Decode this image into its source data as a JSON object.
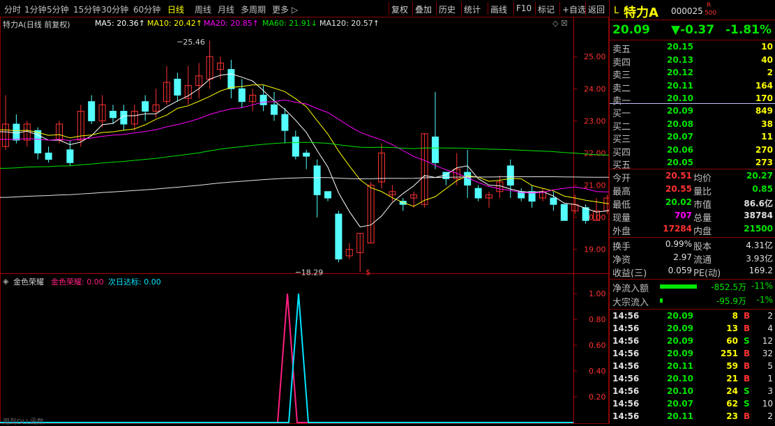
{
  "toolbar": {
    "left_items": [
      "分时",
      "1分钟",
      "5分钟",
      "15分钟",
      "30分钟",
      "60分钟",
      "日线",
      "周线",
      "月线",
      "多周期",
      "更多 ▷"
    ],
    "active_index": 6,
    "right_items": [
      "复权",
      "叠加",
      "历史",
      "统计",
      "画线",
      "F10",
      "标记",
      "+自选",
      "返回"
    ]
  },
  "chart_header": {
    "title": "特力A(日线 前复权)",
    "ma5": "MA5: 20.36↑",
    "ma10": "MA10: 20.42↑",
    "ma20": "MA20: 20.85↑",
    "ma60": "MA60: 21.91↓",
    "ma120": "MA120: 20.57↑",
    "icons": "◇ ☒"
  },
  "chart_data": [
    {
      "type": "candlestick",
      "ylim": [
        18.5,
        25.3
      ],
      "y_ticks": [
        "25.00",
        "24.00",
        "23.00",
        "22.00",
        "21.00",
        "20.00",
        "19.00"
      ],
      "annotations": [
        {
          "text": "25.46",
          "x": 16,
          "y": 25.46
        },
        {
          "text": "18.29",
          "x": 27,
          "y": 18.29
        },
        {
          "text": "$",
          "x": 33,
          "y": 18.3
        }
      ],
      "candles": [
        [
          22.2,
          22.9,
          22.1,
          23.8
        ],
        [
          22.9,
          22.4,
          22.3,
          23.2
        ],
        [
          22.4,
          22.9,
          22.2,
          23.0
        ],
        [
          22.7,
          22.0,
          21.8,
          22.8
        ],
        [
          22.0,
          21.8,
          21.7,
          22.2
        ],
        [
          22.4,
          22.9,
          22.3,
          23.0
        ],
        [
          22.1,
          21.7,
          21.6,
          22.4
        ],
        [
          22.4,
          23.3,
          22.2,
          23.5
        ],
        [
          23.6,
          23.0,
          22.9,
          23.8
        ],
        [
          23.0,
          23.5,
          22.8,
          23.8
        ],
        [
          23.3,
          23.1,
          22.9,
          23.5
        ],
        [
          23.3,
          22.9,
          22.7,
          23.5
        ],
        [
          22.9,
          23.3,
          22.7,
          23.5
        ],
        [
          23.6,
          23.3,
          23.0,
          23.8
        ],
        [
          23.3,
          23.5,
          23.1,
          24.0
        ],
        [
          23.6,
          24.2,
          23.5,
          24.7
        ],
        [
          24.3,
          23.8,
          23.6,
          24.5
        ],
        [
          23.7,
          24.1,
          23.5,
          24.7
        ],
        [
          24.1,
          24.4,
          23.7,
          24.8
        ],
        [
          24.3,
          25.0,
          24.0,
          25.5
        ],
        [
          24.6,
          24.8,
          24.3,
          25.0
        ],
        [
          24.6,
          24.0,
          23.7,
          24.9
        ],
        [
          24.0,
          23.6,
          23.4,
          24.3
        ],
        [
          23.6,
          23.8,
          23.3,
          24.0
        ],
        [
          23.8,
          23.5,
          23.3,
          24.1
        ],
        [
          23.5,
          23.2,
          23.0,
          23.9
        ],
        [
          23.2,
          22.7,
          22.3,
          23.4
        ],
        [
          22.5,
          21.9,
          21.8,
          22.7
        ],
        [
          22.0,
          21.9,
          21.5,
          22.1
        ],
        [
          21.6,
          20.7,
          20.0,
          21.8
        ],
        [
          20.8,
          20.6,
          20.5,
          20.8
        ],
        [
          20.1,
          18.7,
          18.6,
          20.2
        ],
        [
          18.8,
          19.0,
          18.7,
          19.2
        ],
        [
          18.9,
          19.5,
          18.3,
          19.5
        ],
        [
          19.2,
          21.0,
          19.2,
          21.1
        ],
        [
          21.1,
          22.0,
          20.9,
          22.3
        ],
        [
          20.7,
          20.8,
          20.5,
          21.0
        ],
        [
          20.5,
          20.4,
          20.2,
          20.6
        ],
        [
          20.6,
          20.7,
          20.3,
          20.8
        ],
        [
          20.4,
          22.6,
          20.3,
          22.6
        ],
        [
          22.5,
          21.7,
          21.5,
          23.9
        ],
        [
          21.4,
          21.2,
          21.0,
          21.4
        ],
        [
          21.2,
          21.5,
          21.0,
          22.0
        ],
        [
          21.4,
          21.0,
          20.6,
          22.1
        ],
        [
          20.9,
          20.6,
          20.5,
          21.0
        ],
        [
          20.6,
          20.7,
          20.3,
          20.8
        ],
        [
          20.8,
          21.1,
          20.6,
          21.3
        ],
        [
          21.6,
          21.0,
          20.6,
          21.8
        ],
        [
          20.8,
          20.6,
          20.5,
          20.9
        ],
        [
          20.8,
          20.5,
          20.3,
          21.0
        ],
        [
          20.6,
          20.8,
          20.5,
          20.9
        ],
        [
          20.6,
          20.4,
          20.2,
          20.8
        ],
        [
          20.4,
          19.9,
          19.9,
          20.4
        ],
        [
          20.2,
          20.4,
          20.1,
          20.7
        ],
        [
          20.3,
          19.9,
          19.8,
          20.4
        ],
        [
          19.9,
          20.2,
          19.9,
          20.6
        ],
        [
          20.2,
          20.6,
          20.1,
          20.7
        ],
        [
          20.5,
          20.6,
          20.4,
          20.8
        ],
        [
          20.5,
          20.7,
          20.3,
          21.7
        ]
      ],
      "ma_colors": {
        "ma5": "#ffffff",
        "ma10": "#ffff00",
        "ma20": "#ff00ff",
        "ma60": "#00e600",
        "ma120": "#e6e6e6"
      }
    },
    {
      "type": "line",
      "title": "金色荣耀",
      "series": [
        {
          "name": "金色荣耀",
          "values": [
            0,
            0,
            0,
            1,
            0,
            0,
            0
          ],
          "color": "#ff2080"
        },
        {
          "name": "次日达标",
          "values": [
            0,
            0,
            0,
            0,
            1,
            0,
            0
          ],
          "color": "#00e5ff"
        }
      ],
      "y_ticks": [
        "1.00",
        "0.80",
        "0.60",
        "0.40",
        "0.20"
      ],
      "ylim": [
        0,
        1.05
      ]
    }
  ],
  "indicator_header": {
    "name": "金色荣耀",
    "v1": "金色荣耀: 0.00",
    "v2": "次日达标: 0.00"
  },
  "bottom_note": "用到DLL函数",
  "quote": {
    "flag": "L",
    "name": "特力A",
    "code": "000025",
    "badge_top": "R",
    "badge_bottom": "500",
    "price": "20.09",
    "change": "▼-0.37",
    "change_pct": "-1.81%"
  },
  "order_book": {
    "asks": [
      {
        "label": "卖五",
        "price": "20.15",
        "vol": "10"
      },
      {
        "label": "卖四",
        "price": "20.13",
        "vol": "40"
      },
      {
        "label": "卖三",
        "price": "20.12",
        "vol": "2"
      },
      {
        "label": "卖二",
        "price": "20.11",
        "vol": "164"
      },
      {
        "label": "卖一",
        "price": "20.10",
        "vol": "170"
      }
    ],
    "bids": [
      {
        "label": "买一",
        "price": "20.09",
        "vol": "849"
      },
      {
        "label": "买二",
        "price": "20.08",
        "vol": "38"
      },
      {
        "label": "买三",
        "price": "20.07",
        "vol": "11"
      },
      {
        "label": "买四",
        "price": "20.06",
        "vol": "270"
      },
      {
        "label": "买五",
        "price": "20.05",
        "vol": "273"
      }
    ]
  },
  "stats": [
    {
      "l1": "今开",
      "v1": "20.51",
      "c1": "red",
      "l2": "均价",
      "v2": "20.27",
      "c2": "green"
    },
    {
      "l1": "最高",
      "v1": "20.55",
      "c1": "red",
      "l2": "量比",
      "v2": "0.85",
      "c2": "green"
    },
    {
      "l1": "最低",
      "v1": "20.02",
      "c1": "green",
      "l2": "市值",
      "v2": "86.6亿",
      "c2": "white"
    },
    {
      "l1": "现量",
      "v1": "707",
      "c1": "magenta",
      "l2": "总量",
      "v2": "38784",
      "c2": "white"
    },
    {
      "l1": "外盘",
      "v1": "17284",
      "c1": "red",
      "l2": "内盘",
      "v2": "21500",
      "c2": "green"
    }
  ],
  "finance": [
    {
      "l1": "换手",
      "v1": "0.99%",
      "l2": "股本",
      "v2": "4.31亿"
    },
    {
      "l1": "净资",
      "v1": "2.97",
      "l2": "流通",
      "v2": "3.93亿"
    },
    {
      "l1": "收益(三)",
      "v1": "0.059",
      "l2": "PE(动)",
      "v2": "169.2"
    }
  ],
  "flows": [
    {
      "label": "净流入额",
      "value": "-852.5万",
      "pct": "-11%",
      "bar": 0.95
    },
    {
      "label": "大宗流入",
      "value": "-95.9万",
      "pct": "-1%",
      "bar": 0.06
    }
  ],
  "ticks": [
    {
      "time": "14:56",
      "price": "20.09",
      "vol": "8",
      "side": "B",
      "n": "2"
    },
    {
      "time": "14:56",
      "price": "20.09",
      "vol": "13",
      "side": "B",
      "n": "4"
    },
    {
      "time": "14:56",
      "price": "20.09",
      "vol": "60",
      "side": "S",
      "n": "12"
    },
    {
      "time": "14:56",
      "price": "20.09",
      "vol": "251",
      "side": "B",
      "n": "32"
    },
    {
      "time": "14:56",
      "price": "20.11",
      "vol": "59",
      "side": "B",
      "n": "5"
    },
    {
      "time": "14:56",
      "price": "20.10",
      "vol": "21",
      "side": "B",
      "n": "1"
    },
    {
      "time": "14:56",
      "price": "20.10",
      "vol": "24",
      "side": "S",
      "n": "3"
    },
    {
      "time": "14:56",
      "price": "20.07",
      "vol": "62",
      "side": "S",
      "n": "10"
    },
    {
      "time": "14:56",
      "price": "20.11",
      "vol": "23",
      "side": "B",
      "n": "2"
    }
  ]
}
